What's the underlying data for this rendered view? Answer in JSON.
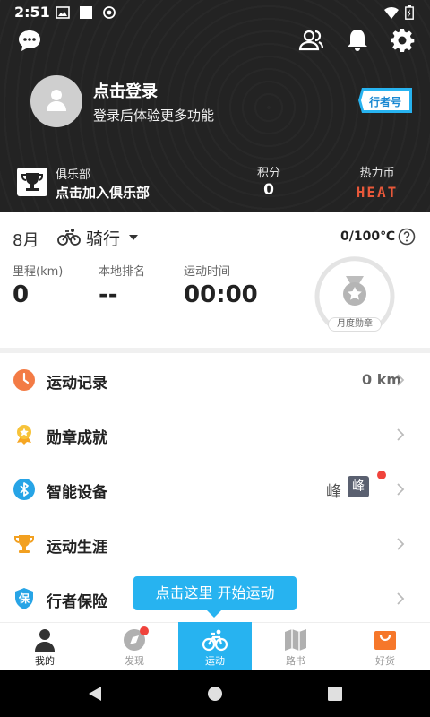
{
  "status_bar": {
    "time": "2:51"
  },
  "profile": {
    "login_title": "点击登录",
    "login_subtitle": "登录后体验更多功能",
    "walker_badge": "行者号"
  },
  "club": {
    "label": "俱乐部",
    "join": "点击加入俱乐部"
  },
  "points": {
    "label": "积分",
    "value": "0"
  },
  "heat_coin": {
    "label": "热力币",
    "logo": "HEAT"
  },
  "stats": {
    "month": "8月",
    "sport": "骑行",
    "goal": "0/100℃",
    "mileage_label": "里程(km)",
    "mileage_value": "0",
    "rank_label": "本地排名",
    "rank_value": "--",
    "time_label": "运动时间",
    "time_value": "00:00",
    "medal_caption": "月度勋章"
  },
  "menu": [
    {
      "label": "运动记录",
      "icon": "clock-icon",
      "value": "0 km"
    },
    {
      "label": "勋章成就",
      "icon": "medal-icon"
    },
    {
      "label": "智能设备",
      "icon": "bluetooth-icon",
      "device_text": "峰",
      "device_badge": "峰"
    },
    {
      "label": "运动生涯",
      "icon": "trophy-icon"
    },
    {
      "label": "行者保险",
      "icon": "insurance-icon",
      "icon_text": "保"
    }
  ],
  "tooltip": "点击这里 开始运动",
  "bottom_nav": [
    {
      "label": "我的",
      "icon": "person-icon"
    },
    {
      "label": "发现",
      "icon": "compass-icon"
    },
    {
      "label": "运动",
      "icon": "bike-icon"
    },
    {
      "label": "路书",
      "icon": "map-icon"
    },
    {
      "label": "好货",
      "icon": "shopping-bag-icon"
    }
  ],
  "colors": {
    "header_bg": "#232323",
    "accent": "#27b3f0",
    "notification": "#f0433c",
    "heat": "#e8583a"
  }
}
